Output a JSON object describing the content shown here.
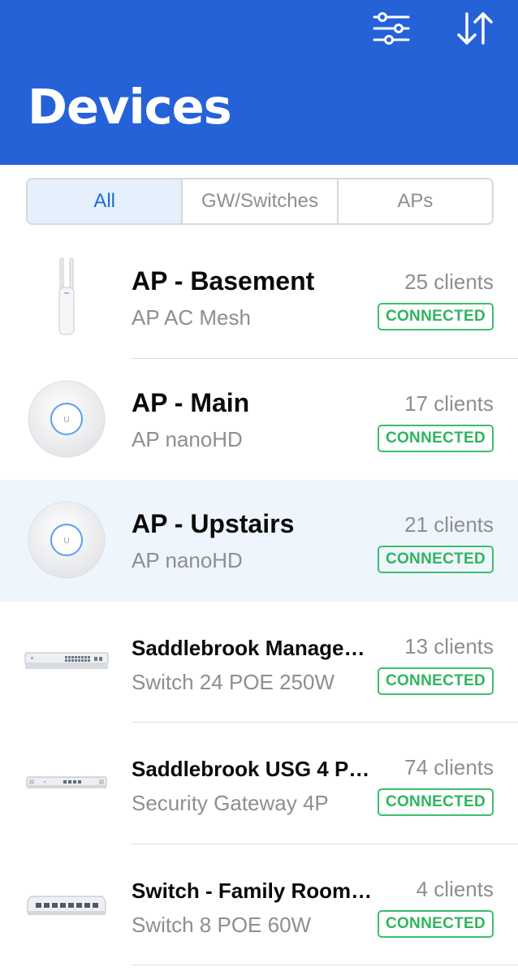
{
  "header": {
    "title": "Devices",
    "background_color": "#2562d8",
    "filter_icon": "sliders-icon",
    "sort_icon": "sort-arrows-icon"
  },
  "filter_tabs": [
    {
      "label": "All",
      "active": true
    },
    {
      "label": "GW/Switches",
      "active": false
    },
    {
      "label": "APs",
      "active": false
    }
  ],
  "devices": [
    {
      "name": "AP - Basement",
      "model": "AP AC Mesh",
      "clients": "25 clients",
      "status": "CONNECTED",
      "icon": "ap-mesh-icon"
    },
    {
      "name": "AP - Main",
      "model": "AP nanoHD",
      "clients": "17 clients",
      "status": "CONNECTED",
      "icon": "ap-nanohd-icon"
    },
    {
      "name": "AP - Upstairs",
      "model": "AP nanoHD",
      "clients": "21 clients",
      "status": "CONNECTED",
      "icon": "ap-nanohd-icon",
      "selected": true
    },
    {
      "name": "Saddlebrook Managed…",
      "model": "Switch 24 POE 250W",
      "clients": "13 clients",
      "status": "CONNECTED",
      "icon": "switch-24-icon"
    },
    {
      "name": "Saddlebrook USG 4 Pr…",
      "model": "Security Gateway 4P",
      "clients": "74 clients",
      "status": "CONNECTED",
      "icon": "gateway-icon"
    },
    {
      "name": "Switch - Family Room -…",
      "model": "Switch 8 POE 60W",
      "clients": "4 clients",
      "status": "CONNECTED",
      "icon": "switch-8-icon"
    }
  ],
  "colors": {
    "accent": "#2562d8",
    "active_tab_text": "#1b6bd6",
    "connected": "#2fb55d",
    "selected_row": "#eff5fd"
  }
}
